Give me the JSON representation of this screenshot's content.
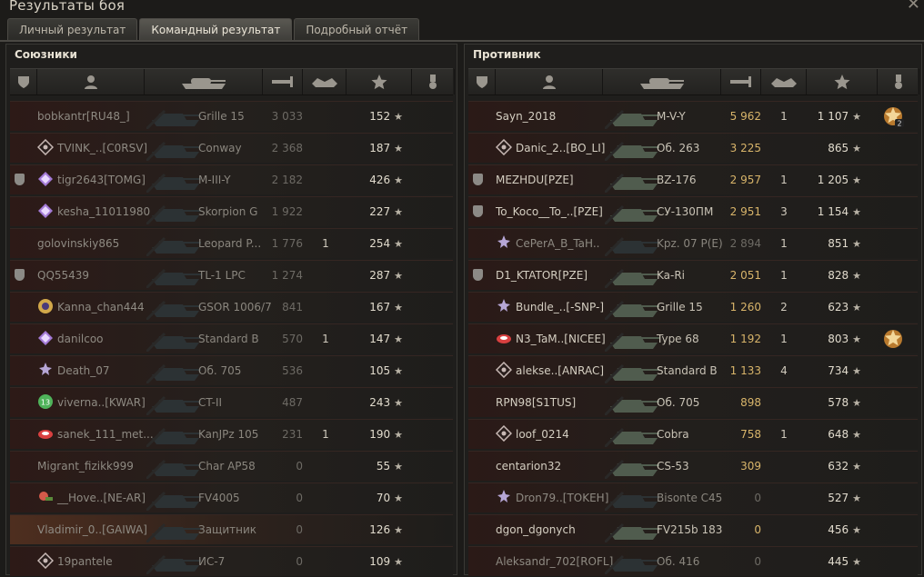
{
  "window": {
    "title": "Результаты боя"
  },
  "tabs": [
    {
      "label": "Личный результат",
      "active": false
    },
    {
      "label": "Командный результат",
      "active": true
    },
    {
      "label": "Подробный отчёт",
      "active": false
    }
  ],
  "columns": [
    "squad-icon",
    "player-icon",
    "tank-icon",
    "damage-icon",
    "kills-icon",
    "star-icon",
    "medal-icon"
  ],
  "allies": {
    "title": "Союзники",
    "rows": [
      {
        "name": "bobkantr[RU48_]",
        "vehicle": "Grille 15",
        "damage": "3 033",
        "kills": "",
        "xp": "152",
        "alive": false,
        "mark": "",
        "squad": false
      },
      {
        "name": "TVINK_..[C0RSV]",
        "vehicle": "Conway",
        "damage": "2 368",
        "kills": "",
        "xp": "187",
        "alive": false,
        "mark": "diamond",
        "squad": false
      },
      {
        "name": "tigr2643[TOMG]",
        "vehicle": "M-III-Y",
        "damage": "2 182",
        "kills": "",
        "xp": "426",
        "alive": false,
        "mark": "purple",
        "squad": true
      },
      {
        "name": "kesha_11011980",
        "vehicle": "Skorpion G",
        "damage": "1 922",
        "kills": "",
        "xp": "227",
        "alive": false,
        "mark": "purple",
        "squad": false
      },
      {
        "name": "golovinskiy865",
        "vehicle": "Leopard P...",
        "damage": "1 776",
        "kills": "1",
        "xp": "254",
        "alive": false,
        "mark": "",
        "squad": false
      },
      {
        "name": "QQ55439",
        "vehicle": "TL-1 LPC",
        "damage": "1 274",
        "kills": "",
        "xp": "287",
        "alive": false,
        "mark": "",
        "squad": true
      },
      {
        "name": "Kanna_chan444",
        "vehicle": "GSOR 1006/7",
        "damage": "841",
        "kills": "",
        "xp": "167",
        "alive": false,
        "mark": "gold",
        "squad": false
      },
      {
        "name": "danilcoo",
        "vehicle": "Standard B",
        "damage": "570",
        "kills": "1",
        "xp": "147",
        "alive": false,
        "mark": "purple",
        "squad": false
      },
      {
        "name": "Death_07",
        "vehicle": "Об. 705",
        "damage": "536",
        "kills": "",
        "xp": "105",
        "alive": false,
        "mark": "star",
        "squad": false
      },
      {
        "name": "viverna..[KWAR]",
        "vehicle": "CT-II",
        "damage": "487",
        "kills": "",
        "xp": "243",
        "alive": false,
        "mark": "green",
        "squad": false
      },
      {
        "name": "sanek_111_met...",
        "vehicle": "KanJPz 105",
        "damage": "231",
        "kills": "1",
        "xp": "190",
        "alive": false,
        "mark": "red",
        "squad": false
      },
      {
        "name": "Migrant_fizikk999",
        "vehicle": "Char AP58",
        "damage": "0",
        "kills": "",
        "xp": "55",
        "alive": false,
        "mark": "",
        "squad": false
      },
      {
        "name": "__Hove..[NE-AR]",
        "vehicle": "FV4005",
        "damage": "0",
        "kills": "",
        "xp": "70",
        "alive": false,
        "mark": "flower",
        "squad": false
      },
      {
        "name": "Vladimir_0..[GAIWA]",
        "vehicle": "Защитник",
        "damage": "0",
        "kills": "",
        "xp": "126",
        "alive": false,
        "mark": "",
        "squad": false,
        "highlight": true
      },
      {
        "name": "19pantele",
        "vehicle": "ИС-7",
        "damage": "0",
        "kills": "",
        "xp": "109",
        "alive": false,
        "mark": "diamond",
        "squad": false
      }
    ]
  },
  "enemies": {
    "title": "Противник",
    "rows": [
      {
        "name": "Sayn_2018",
        "vehicle": "M-V-Y",
        "damage": "5 962",
        "kills": "1",
        "xp": "1 107",
        "alive": true,
        "mark": "",
        "squad": false,
        "medal": "2"
      },
      {
        "name": "Danic_2..[BO_LI]",
        "vehicle": "Об. 263",
        "damage": "3 225",
        "kills": "",
        "xp": "865",
        "alive": true,
        "mark": "diamond",
        "squad": false
      },
      {
        "name": "MEZHDU[PZE]",
        "vehicle": "BZ-176",
        "damage": "2 957",
        "kills": "1",
        "xp": "1 205",
        "alive": true,
        "mark": "",
        "squad": true
      },
      {
        "name": "To_Koco__To_..[PZE]",
        "vehicle": "СУ-130ПМ",
        "damage": "2 951",
        "kills": "3",
        "xp": "1 154",
        "alive": true,
        "mark": "",
        "squad": true
      },
      {
        "name": "CePerA_B_TaH..",
        "vehicle": "Kpz. 07 P(E)",
        "damage": "2 894",
        "kills": "1",
        "xp": "851",
        "alive": false,
        "mark": "star",
        "squad": false
      },
      {
        "name": "D1_KTATOR[PZE]",
        "vehicle": "Ka-Ri",
        "damage": "2 051",
        "kills": "1",
        "xp": "828",
        "alive": true,
        "mark": "",
        "squad": true
      },
      {
        "name": "Bundle_..[-SNP-]",
        "vehicle": "Grille 15",
        "damage": "1 260",
        "kills": "2",
        "xp": "623",
        "alive": true,
        "mark": "star",
        "squad": false
      },
      {
        "name": "N3_TaM..[NICEE]",
        "vehicle": "Type 68",
        "damage": "1 192",
        "kills": "1",
        "xp": "803",
        "alive": true,
        "mark": "red",
        "squad": false,
        "medal": ""
      },
      {
        "name": "alekse..[ANRAC]",
        "vehicle": "Standard B",
        "damage": "1 133",
        "kills": "4",
        "xp": "734",
        "alive": true,
        "mark": "diamond",
        "squad": false
      },
      {
        "name": "RPN98[S1TUS]",
        "vehicle": "Об. 705",
        "damage": "898",
        "kills": "",
        "xp": "578",
        "alive": true,
        "mark": "",
        "squad": false
      },
      {
        "name": "loof_0214",
        "vehicle": "Cobra",
        "damage": "758",
        "kills": "1",
        "xp": "648",
        "alive": true,
        "mark": "diamond",
        "squad": false
      },
      {
        "name": "centarion32",
        "vehicle": "CS-53",
        "damage": "309",
        "kills": "",
        "xp": "632",
        "alive": true,
        "mark": "",
        "squad": false
      },
      {
        "name": "Dron79..[TOKEH]",
        "vehicle": "Bisonte C45",
        "damage": "0",
        "kills": "",
        "xp": "527",
        "alive": false,
        "mark": "star",
        "squad": false
      },
      {
        "name": "dgon_dgonych",
        "vehicle": "FV215b 183",
        "damage": "0",
        "kills": "",
        "xp": "456",
        "alive": true,
        "mark": "",
        "squad": false
      },
      {
        "name": "Aleksandr_702[ROFL]",
        "vehicle": "Об. 416",
        "damage": "0",
        "kills": "",
        "xp": "445",
        "alive": false,
        "mark": "",
        "squad": false
      }
    ]
  },
  "colors": {
    "damage_alive": "#d8b46a",
    "damage_dead": "#6d6a64",
    "accent": "#cfc9bb"
  }
}
